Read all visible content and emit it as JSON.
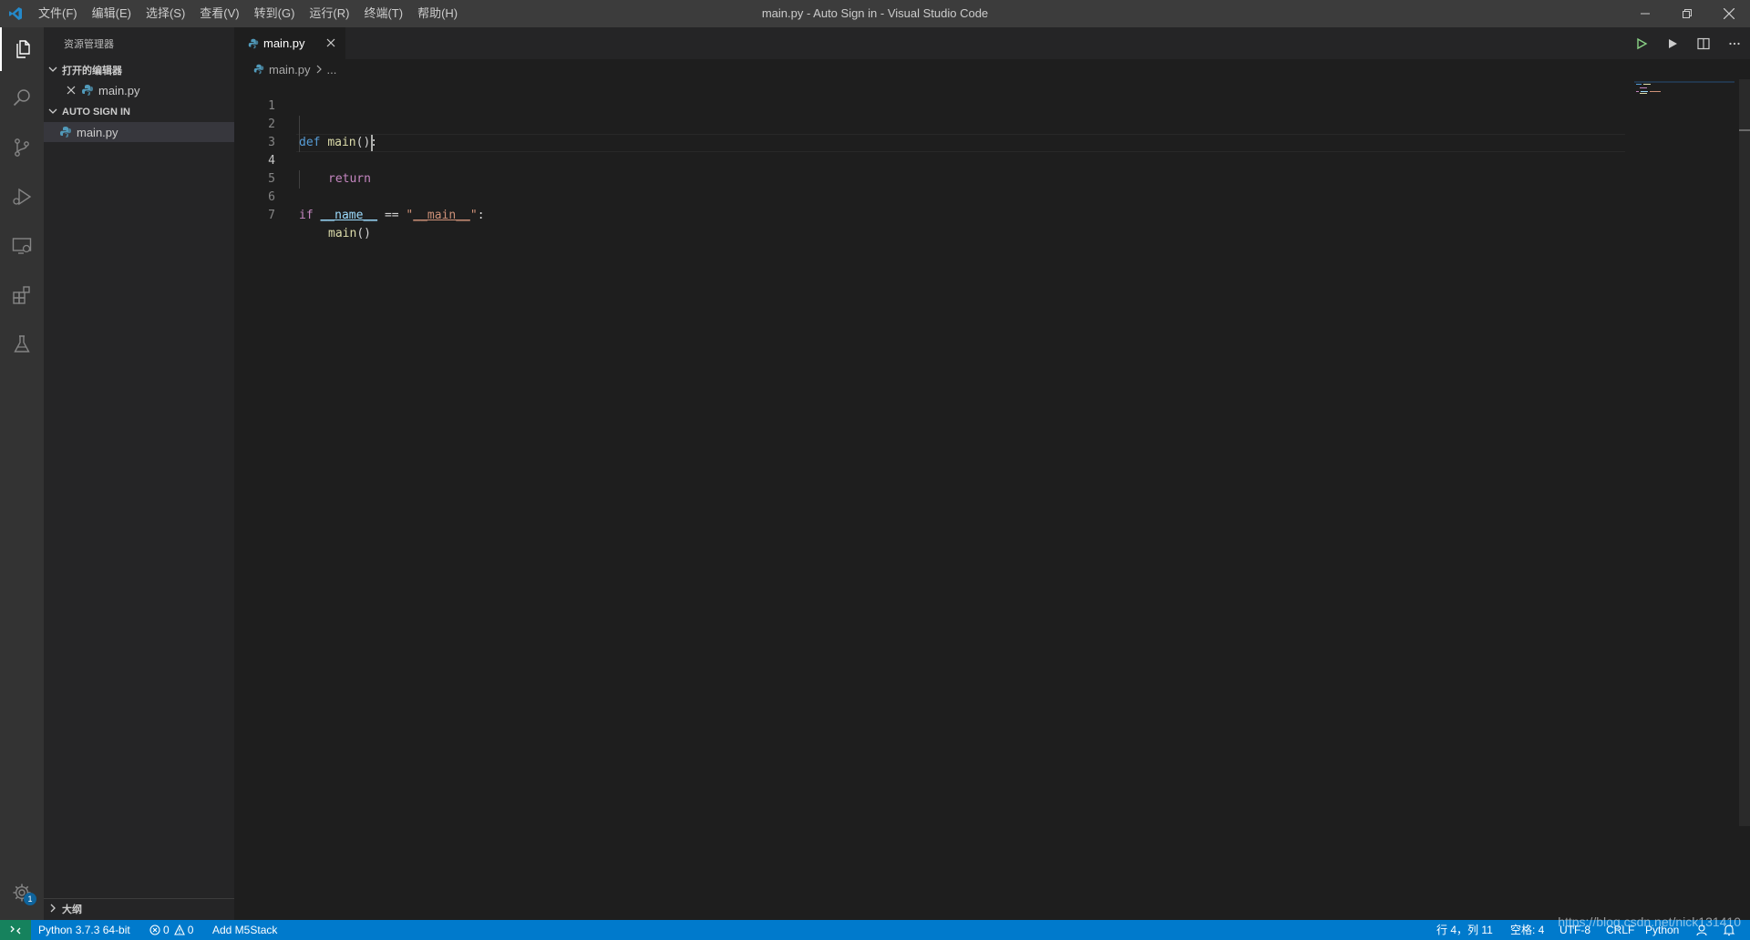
{
  "window": {
    "title": "main.py - Auto Sign in - Visual Studio Code",
    "menu": [
      "文件(F)",
      "编辑(E)",
      "选择(S)",
      "查看(V)",
      "转到(G)",
      "运行(R)",
      "终端(T)",
      "帮助(H)"
    ]
  },
  "activity_bar": {
    "icons": [
      "explorer-icon",
      "search-icon",
      "source-control-icon",
      "run-debug-icon",
      "remote-explorer-icon",
      "extensions-icon",
      "testing-icon",
      "settings-gear-icon"
    ],
    "settings_badge": "1"
  },
  "sidebar": {
    "title": "资源管理器",
    "open_editors": {
      "label": "打开的编辑器",
      "items": [
        {
          "name": "main.py"
        }
      ]
    },
    "folder": {
      "label": "AUTO SIGN IN",
      "items": [
        {
          "name": "main.py"
        }
      ]
    },
    "outline": {
      "label": "大纲"
    }
  },
  "editor": {
    "tab": {
      "label": "main.py"
    },
    "breadcrumb": {
      "file": "main.py",
      "rest": "..."
    },
    "lines": [
      {
        "number": "1"
      },
      {
        "number": "2",
        "tokens": [
          "def",
          "main",
          "():"
        ]
      },
      {
        "number": "3"
      },
      {
        "number": "4",
        "tokens": [
          "return"
        ]
      },
      {
        "number": "5"
      },
      {
        "number": "6",
        "tokens": [
          "if",
          "__name__",
          "==",
          "\"",
          "__main__",
          "\"",
          ":"
        ]
      },
      {
        "number": "7",
        "tokens": [
          "main",
          "()"
        ]
      }
    ]
  },
  "status_bar": {
    "interpreter": "Python 3.7.3 64-bit",
    "errors": "0",
    "warnings": "0",
    "extension": "Add M5Stack",
    "cursor_position": "行 4，列 11",
    "indentation": "空格: 4",
    "encoding": "UTF-8",
    "eol": "CRLF",
    "language": "Python",
    "watermark": "https://blog.csdn.net/nick131410"
  },
  "colors": {
    "accent": "#007acc",
    "remote": "#16825d",
    "keyword": "#569cd6",
    "control_keyword": "#c586c0",
    "function": "#dcdcaa",
    "variable": "#9cdcfe",
    "string": "#ce9178"
  }
}
